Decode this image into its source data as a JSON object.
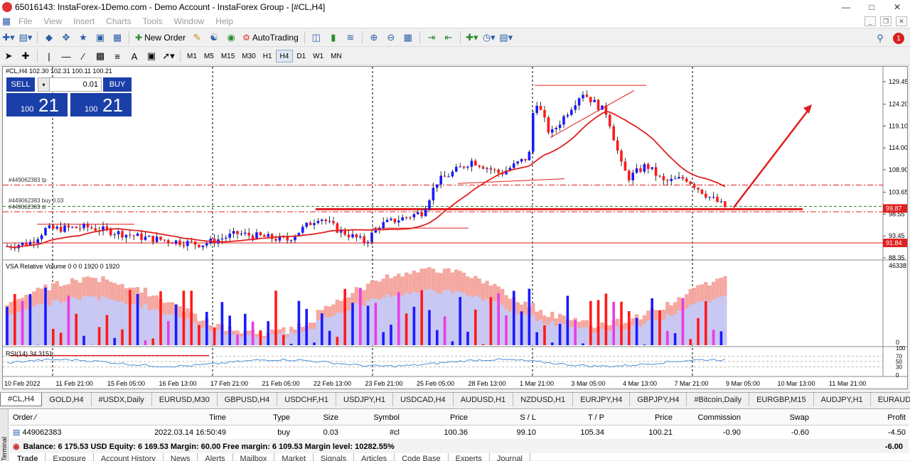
{
  "window": {
    "title": "65016143: InstaForex-1Demo.com - Demo Account - InstaForex Group - [#CL,H4]"
  },
  "menu": [
    "File",
    "View",
    "Insert",
    "Charts",
    "Tools",
    "Window",
    "Help"
  ],
  "toolbar": {
    "new_order": "New Order",
    "autotrading": "AutoTrading",
    "notifications": "1"
  },
  "timeframes": [
    "M1",
    "M5",
    "M15",
    "M30",
    "H1",
    "H4",
    "D1",
    "W1",
    "MN"
  ],
  "active_timeframe": "H4",
  "chart": {
    "symbol_info": "#CL,H4  102.30 102.31 100.11 100.21",
    "sell_label": "SELL",
    "buy_label": "BUY",
    "lot": "0.01",
    "sell_small": "100",
    "sell_big": "21",
    "buy_small": "100",
    "buy_big": "21",
    "tp_label": "#449062383 tp",
    "buy_label_line": "#449062383 buy 0.03",
    "sl_label": "#449062383 sl",
    "price_labels": [
      "129.45",
      "124.20",
      "119.10",
      "114.00",
      "108.90",
      "103.65",
      "98.55",
      "93.45",
      "88.35"
    ],
    "current_price": "99.87",
    "level_price": "91.84",
    "vsa_label": "VSA Relative Volume 0 0 0 1920 0 1920",
    "vsa_max": "46338",
    "vsa_min": "0",
    "rsi_label": "RSI(14) 34.3151",
    "rsi_levels": [
      "100",
      "70",
      "50",
      "30",
      "0"
    ],
    "dates": [
      "10 Feb 2022",
      "11 Feb 21:00",
      "15 Feb 05:00",
      "16 Feb 13:00",
      "17 Feb 21:00",
      "21 Feb 05:00",
      "22 Feb 13:00",
      "23 Feb 21:00",
      "25 Feb 05:00",
      "28 Feb 13:00",
      "1 Mar 21:00",
      "3 Mar 05:00",
      "4 Mar 13:00",
      "7 Mar 21:00",
      "9 Mar 05:00",
      "10 Mar 13:00",
      "11 Mar 21:00"
    ],
    "colors": {
      "bull": "#1a1aff",
      "bear": "#ff1a1a",
      "ma": "#e02020"
    }
  },
  "symbol_tabs": [
    "#CL,H4",
    "GOLD,H4",
    "#USDX,Daily",
    "EURUSD,M30",
    "GBPUSD,H4",
    "USDCHF,H1",
    "USDJPY,H1",
    "USDCAD,H4",
    "AUDUSD,H1",
    "NZDUSD,H1",
    "EURJPY,H4",
    "GBPJPY,H4",
    "#Bitcoin,Daily",
    "EURGBP,M15",
    "AUDJPY,H1",
    "EURAUD,M"
  ],
  "terminal": {
    "side_label": "Terminal",
    "columns": [
      "Order",
      "Time",
      "Type",
      "Size",
      "Symbol",
      "Price",
      "S / L",
      "T / P",
      "Price",
      "Commission",
      "Swap",
      "Profit"
    ],
    "row": [
      "449062383",
      "2022.03.14 16:50:49",
      "buy",
      "0.03",
      "#cl",
      "100.36",
      "99.10",
      "105.34",
      "100.21",
      "-0.90",
      "-0.60",
      "-4.50"
    ],
    "balance": "Balance: 6 175.53 USD  Equity: 6 169.53  Margin: 60.00  Free margin: 6 109.53  Margin level: 10282.55%",
    "total": "-6.00",
    "tabs": [
      "Trade",
      "Exposure",
      "Account History",
      "News",
      "Alerts",
      "Mailbox",
      "Market",
      "Signals",
      "Articles",
      "Code Base",
      "Experts",
      "Journal"
    ]
  }
}
